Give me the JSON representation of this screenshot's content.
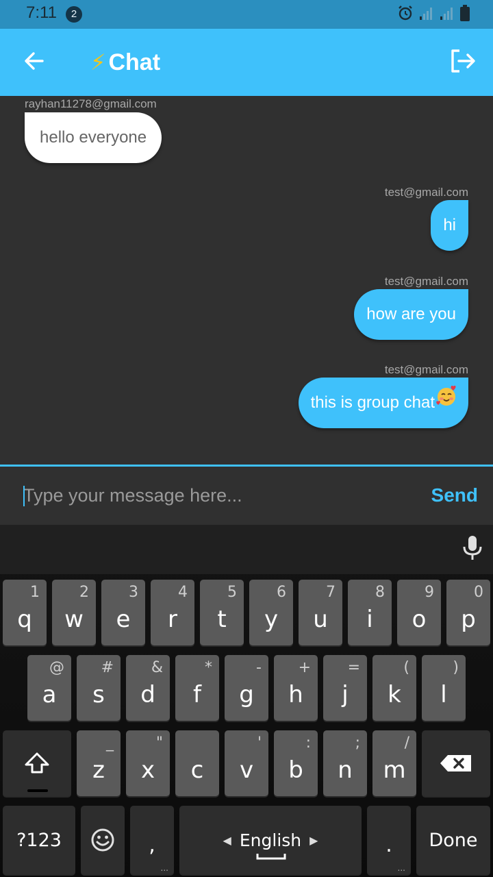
{
  "status_bar": {
    "time": "7:11",
    "notification_count": "2"
  },
  "app_bar": {
    "bolt_glyph": "⚡",
    "title": "Chat"
  },
  "messages": [
    {
      "sender": "rayhan11278@gmail.com",
      "text": "hello everyone",
      "direction": "incoming"
    },
    {
      "sender": "test@gmail.com",
      "text": "hi",
      "direction": "outgoing"
    },
    {
      "sender": "test@gmail.com",
      "text": "how are you",
      "direction": "outgoing"
    },
    {
      "sender": "test@gmail.com",
      "text": "this is group chat",
      "direction": "outgoing",
      "emoji": "smiling-face-with-hearts"
    }
  ],
  "composer": {
    "placeholder": "Type your message here...",
    "value": "",
    "send_label": "Send"
  },
  "colors": {
    "accent": "#3fc1fb",
    "status_bar": "#2b8fbf",
    "background": "#303030"
  },
  "keyboard": {
    "row1": [
      {
        "key": "q",
        "sub": "1"
      },
      {
        "key": "w",
        "sub": "2"
      },
      {
        "key": "e",
        "sub": "3"
      },
      {
        "key": "r",
        "sub": "4"
      },
      {
        "key": "t",
        "sub": "5"
      },
      {
        "key": "y",
        "sub": "6"
      },
      {
        "key": "u",
        "sub": "7"
      },
      {
        "key": "i",
        "sub": "8"
      },
      {
        "key": "o",
        "sub": "9"
      },
      {
        "key": "p",
        "sub": "0"
      }
    ],
    "row2": [
      {
        "key": "a",
        "sub": "@"
      },
      {
        "key": "s",
        "sub": "#"
      },
      {
        "key": "d",
        "sub": "&"
      },
      {
        "key": "f",
        "sub": "*"
      },
      {
        "key": "g",
        "sub": "-"
      },
      {
        "key": "h",
        "sub": "+"
      },
      {
        "key": "j",
        "sub": "="
      },
      {
        "key": "k",
        "sub": "("
      },
      {
        "key": "l",
        "sub": ")"
      }
    ],
    "row3": [
      {
        "key": "z",
        "sub": "_"
      },
      {
        "key": "x",
        "sub": "\""
      },
      {
        "key": "c",
        "sub": ""
      },
      {
        "key": "v",
        "sub": "'"
      },
      {
        "key": "b",
        "sub": ":"
      },
      {
        "key": "n",
        "sub": ";"
      },
      {
        "key": "m",
        "sub": "/"
      }
    ],
    "symbols_label": "?123",
    "comma": ",",
    "space_label": "English",
    "period": ".",
    "done_label": "Done"
  }
}
